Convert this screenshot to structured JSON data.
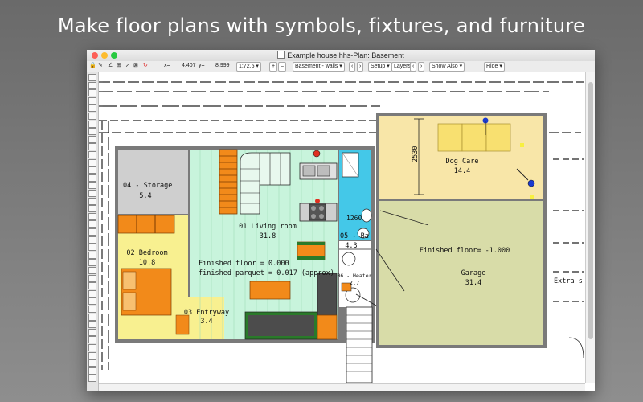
{
  "headline": "Make floor plans with symbols, fixtures, and furniture",
  "window": {
    "title": "Example house.hhs-Plan: Basement",
    "colors": {
      "close": "#fc5f57",
      "minimize": "#fdbc2e",
      "zoom": "#28c940"
    }
  },
  "toolbar": {
    "x_label": "x=",
    "x_value": "4.407",
    "y_label": "y=",
    "y_value": "8.999",
    "scale": "1:72.5",
    "plus": "+",
    "minus": "–",
    "layer": "Basement - walls",
    "setup": "Setup",
    "layers": "Layers",
    "show_also": "Show Also",
    "hide": "Hide"
  },
  "tools": [
    "arrow",
    "select",
    "hand",
    "zoom-in",
    "zoom-out",
    "rect",
    "ellipse",
    "line",
    "wall",
    "door",
    "window",
    "stair",
    "text",
    "dimension",
    "polygon",
    "arc",
    "fill",
    "symbol",
    "grid",
    "measure",
    "rotate",
    "mirror",
    "group",
    "ungroup",
    "align",
    "layer",
    "lock",
    "snap",
    "help",
    "settings",
    "print",
    "export",
    "library",
    "camera",
    "light",
    "plant",
    "note",
    "scale",
    "more",
    "end"
  ],
  "rooms": {
    "storage": {
      "name": "04 - Storage",
      "area": "5.4"
    },
    "living": {
      "name": "01 Living room",
      "area": "31.8"
    },
    "bath": {
      "name": "05 - Bath",
      "area": "4.3"
    },
    "bath_short": "05 - Ba",
    "bedroom": {
      "name": "02 Bedroom",
      "area": "10.8"
    },
    "entryway": {
      "name": "03 Entryway",
      "area": "3.4"
    },
    "heater": {
      "name": "06 - Heater",
      "area": "2.7"
    },
    "dogcare": {
      "name": "Dog Care",
      "area": "14.4"
    },
    "garage": {
      "name": "Garage",
      "area": "31.4"
    }
  },
  "annotations": {
    "finished_floor": "Finished floor = 0.000",
    "finished_parquet": "finished parquet = 0.017 (approx)",
    "garage_floor": "Finished floor= -1.000",
    "extra": "Extra s",
    "dim_1260": "1260",
    "dim_2530": "2530"
  },
  "fill_colors": {
    "storage": "#cfcfcf",
    "living": "#c8f4dc",
    "bath": "#44c8e8",
    "bedroom": "#f8f090",
    "dogcare": "#f8e6a8",
    "garage": "#d8dca8",
    "furniture": "#f28a1a",
    "sofa": "#4c4c4c",
    "sofa_green": "#2a7a2a",
    "wall": "#7a7a7a"
  }
}
